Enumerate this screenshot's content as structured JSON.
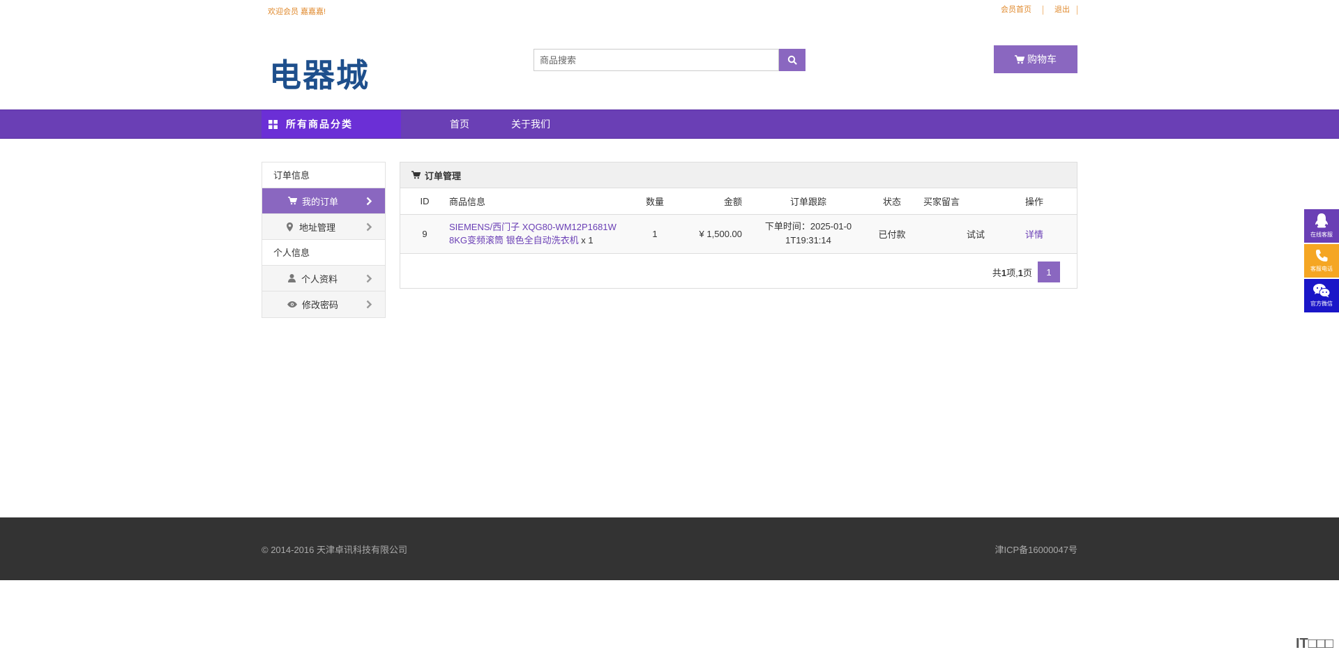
{
  "topbar": {
    "welcome": "欢迎会员 嘉嘉嘉!",
    "links": [
      "会员首页",
      "退出"
    ]
  },
  "header": {
    "logo": "电器城",
    "search_placeholder": "商品搜索",
    "cart_label": "购物车"
  },
  "nav": {
    "category_label": "所有商品分类",
    "links": [
      "首页",
      "关于我们"
    ]
  },
  "sidebar": {
    "group1": "订单信息",
    "group1_items": [
      {
        "label": "我的订单",
        "icon": "cart-icon"
      },
      {
        "label": "地址管理",
        "icon": "map-marker-icon"
      }
    ],
    "group2": "个人信息",
    "group2_items": [
      {
        "label": "个人资料",
        "icon": "user-icon"
      },
      {
        "label": "修改密码",
        "icon": "eye-icon"
      }
    ]
  },
  "panel": {
    "title": "订单管理",
    "columns": [
      "ID",
      "商品信息",
      "数量",
      "金额",
      "订单跟踪",
      "状态",
      "买家留言",
      "操作"
    ],
    "rows": [
      {
        "id": "9",
        "product": "SIEMENS/西门子 XQG80-WM12P1681W 8KG变频滚筒 银色全自动洗衣机",
        "product_qty_suffix": "x 1",
        "qty": "1",
        "amount": "¥ 1,500.00",
        "tracking": "下单时间：2025-01-01T19:31:14",
        "status": "已付款",
        "message": "试试",
        "action": "详情"
      }
    ],
    "pager": {
      "prefix": "共",
      "total": "1",
      "middle": "项,",
      "pages": "1",
      "suffix": "页",
      "current": "1"
    }
  },
  "float": [
    {
      "label": "在线客服",
      "icon": "qq-icon",
      "color": "#6a3fb5"
    },
    {
      "label": "客服电话",
      "icon": "phone-icon",
      "color": "#f5a623"
    },
    {
      "label": "官方微信",
      "icon": "wechat-icon",
      "color": "#1a16c8"
    }
  ],
  "footer": {
    "copyright": "© 2014-2016 天津卓讯科技有限公司",
    "icp": "津ICP备16000047号"
  },
  "watermark": "IT□□□",
  "colors": {
    "accent": "#8a67c0",
    "nav": "#6a3fb5",
    "link": "#6a3fb5",
    "topbar_text": "#e08a2e",
    "footer_bg": "#333333"
  }
}
